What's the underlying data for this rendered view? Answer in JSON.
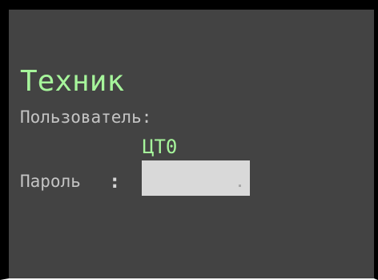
{
  "screen": {
    "title": "Техник",
    "user_label": "Пользователь:",
    "user_value": "ЦТ0",
    "password_label": "Пароль",
    "password_colon": ":",
    "password_value": ""
  },
  "colors": {
    "background": "#434343",
    "accent_green": "#a6f59b",
    "label_gray": "#c4c4c4",
    "field_bg": "#d9d9d9",
    "frame": "#000000"
  }
}
